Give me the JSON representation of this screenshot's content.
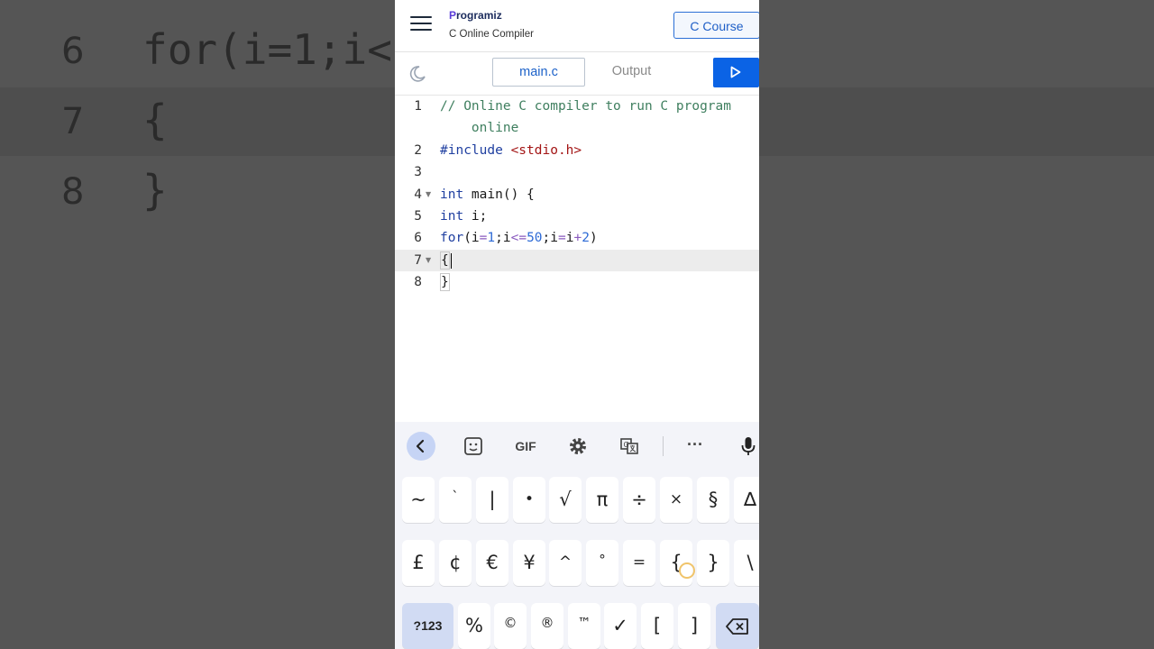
{
  "background": {
    "lines": [
      {
        "num": "6",
        "code": "for(i=1;i<"
      },
      {
        "num": "7",
        "code": "{"
      },
      {
        "num": "8",
        "code": "}"
      }
    ]
  },
  "header": {
    "logo_text": "rogramiz",
    "logo_initial": "P",
    "subtitle": "C Online Compiler",
    "course_button": "C Course"
  },
  "tabs": {
    "file_tab": "main.c",
    "output_tab": "Output"
  },
  "editor": {
    "lines": [
      {
        "n": "1",
        "text": "// Online C compiler to run C program"
      },
      {
        "n": "",
        "text": "    online"
      },
      {
        "n": "2",
        "text": "#include <stdio.h>"
      },
      {
        "n": "3",
        "text": ""
      },
      {
        "n": "4",
        "text": "int main() {"
      },
      {
        "n": "5",
        "text": "int i;"
      },
      {
        "n": "6",
        "text": "for(i=1;i<=50;i=i+2)"
      },
      {
        "n": "7",
        "text": "{"
      },
      {
        "n": "8",
        "text": "}"
      }
    ],
    "active_line": 7
  },
  "keyboard": {
    "toolbar": [
      "back-icon",
      "sticker-icon",
      "GIF",
      "gear-icon",
      "translate-icon",
      "more-icon",
      "mic-icon"
    ],
    "gif_label": "GIF",
    "more_label": "···",
    "row1": [
      "~",
      "`",
      "|",
      "•",
      "√",
      "π",
      "÷",
      "×",
      "§",
      "∆"
    ],
    "row2": [
      "£",
      "¢",
      "€",
      "¥",
      "^",
      "°",
      "=",
      "{",
      "}",
      "\\"
    ],
    "row3": [
      "?123",
      "%",
      "©",
      "®",
      "™",
      "✓",
      "[",
      "]",
      "⌫"
    ]
  },
  "colors": {
    "accent": "#0b63e5",
    "tab_active": "#1d62c9",
    "keyboard_bg": "#f3f4f9",
    "fn_key": "#d1dbf3"
  }
}
